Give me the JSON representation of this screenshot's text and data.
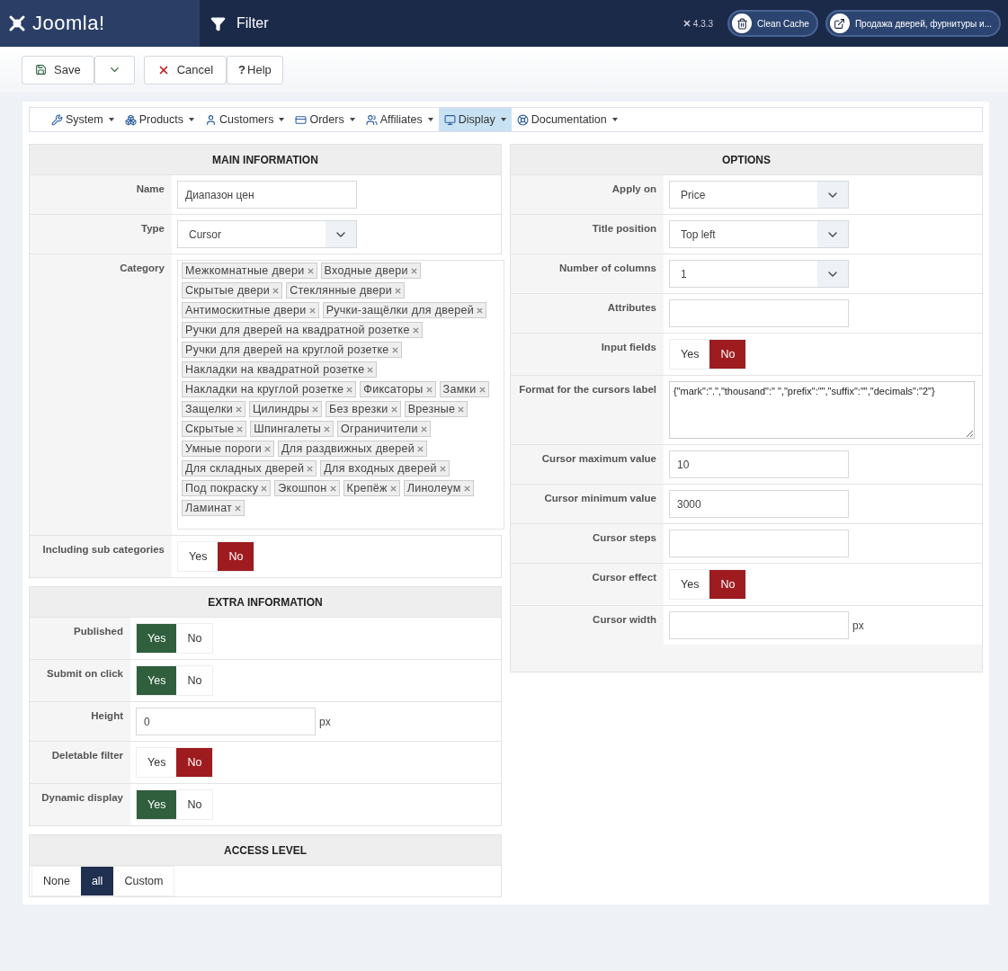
{
  "header": {
    "logo": "Joomla!",
    "title": "Filter",
    "version": "4.3.3",
    "buttons": [
      "Clean Cache",
      "Продажа дверей, фурнитуры и..."
    ]
  },
  "toolbar": {
    "save": "Save",
    "cancel": "Cancel",
    "help_icon": "?",
    "help": "Help"
  },
  "menu": [
    {
      "label": "System",
      "selected": false
    },
    {
      "label": "Products",
      "selected": false
    },
    {
      "label": "Customers",
      "selected": false
    },
    {
      "label": "Orders",
      "selected": false
    },
    {
      "label": "Affiliates",
      "selected": false
    },
    {
      "label": "Display",
      "selected": true
    },
    {
      "label": "Documentation",
      "selected": false
    }
  ],
  "main_information": {
    "title": "MAIN INFORMATION",
    "rows": [
      {
        "kind": "text",
        "label": "Name",
        "value": "Диапазон цен"
      },
      {
        "kind": "select",
        "label": "Type",
        "value": "Cursor"
      },
      {
        "kind": "tags",
        "label": "Category",
        "tags": [
          "Межкомнатные двери",
          "Входные двери",
          "Скрытые двери",
          "Стеклянные двери",
          "Антимоскитные двери",
          "Ручки-защёлки для дверей",
          "Ручки для дверей на квадратной розетке",
          "Ручки для дверей на круглой розетке",
          "Накладки на квадратной розетке",
          "Накладки на круглой розетке",
          "Фиксаторы",
          "Замки",
          "Защелки",
          "Цилиндры",
          "Без врезки",
          "Врезные",
          "Скрытые",
          "Шпингалеты",
          "Ограничители",
          "Умные пороги",
          "Для раздвижных дверей",
          "Для складных дверей",
          "Для входных дверей",
          "Под покраску",
          "Экошпон",
          "Крепёж",
          "Линолеум",
          "Ламинат"
        ]
      },
      {
        "kind": "toggle",
        "label": "Including sub categories",
        "options": [
          {
            "label": "Yes",
            "selected": false,
            "kind": "yes"
          },
          {
            "label": "No",
            "selected": true,
            "kind": "no"
          }
        ]
      }
    ]
  },
  "extra_information": {
    "title": "EXTRA INFORMATION",
    "rows": [
      {
        "kind": "toggle",
        "label": "Published",
        "options": [
          {
            "label": "Yes",
            "selected": true,
            "kind": "yes"
          },
          {
            "label": "No",
            "selected": false,
            "kind": "no"
          }
        ]
      },
      {
        "kind": "toggle",
        "label": "Submit on click",
        "options": [
          {
            "label": "Yes",
            "selected": true,
            "kind": "yes"
          },
          {
            "label": "No",
            "selected": false,
            "kind": "no"
          }
        ]
      },
      {
        "kind": "text",
        "label": "Height",
        "value": "0",
        "unit": "px"
      },
      {
        "kind": "toggle",
        "label": "Deletable filter",
        "options": [
          {
            "label": "Yes",
            "selected": false,
            "kind": "yes"
          },
          {
            "label": "No",
            "selected": true,
            "kind": "no"
          }
        ]
      },
      {
        "kind": "toggle",
        "label": "Dynamic display",
        "options": [
          {
            "label": "Yes",
            "selected": true,
            "kind": "yes"
          },
          {
            "label": "No",
            "selected": false,
            "kind": "no"
          }
        ]
      }
    ]
  },
  "access_level": {
    "title": "ACCESS LEVEL",
    "options": [
      {
        "label": "None",
        "selected": false,
        "kind": "level"
      },
      {
        "label": "all",
        "selected": true,
        "kind": "level"
      },
      {
        "label": "Custom",
        "selected": false,
        "kind": "level"
      }
    ]
  },
  "options": {
    "title": "OPTIONS",
    "rows": [
      {
        "kind": "select",
        "label": "Apply on",
        "value": "Price"
      },
      {
        "kind": "select",
        "label": "Title position",
        "value": "Top left"
      },
      {
        "kind": "select",
        "label": "Number of columns",
        "value": "1"
      },
      {
        "kind": "text",
        "label": "Attributes"
      },
      {
        "kind": "toggle",
        "label": "Input fields",
        "options": [
          {
            "label": "Yes",
            "selected": false,
            "kind": "yes"
          },
          {
            "label": "No",
            "selected": true,
            "kind": "no"
          }
        ]
      },
      {
        "kind": "textarea",
        "label": "Format for the cursors label",
        "value": "{\"mark\":\".\",\"thousand\":\" \",\"prefix\":\"\",\"suffix\":\"\",\"decimals\":\"2\"}"
      },
      {
        "kind": "text",
        "label": "Cursor maximum value",
        "value": "10"
      },
      {
        "kind": "text",
        "label": "Cursor minimum value",
        "value": "3000"
      },
      {
        "kind": "text",
        "label": "Cursor steps"
      },
      {
        "kind": "toggle",
        "label": "Cursor effect",
        "options": [
          {
            "label": "Yes",
            "selected": false,
            "kind": "yes"
          },
          {
            "label": "No",
            "selected": true,
            "kind": "no"
          }
        ]
      },
      {
        "kind": "text",
        "label": "Cursor width",
        "unit": "px"
      }
    ]
  }
}
